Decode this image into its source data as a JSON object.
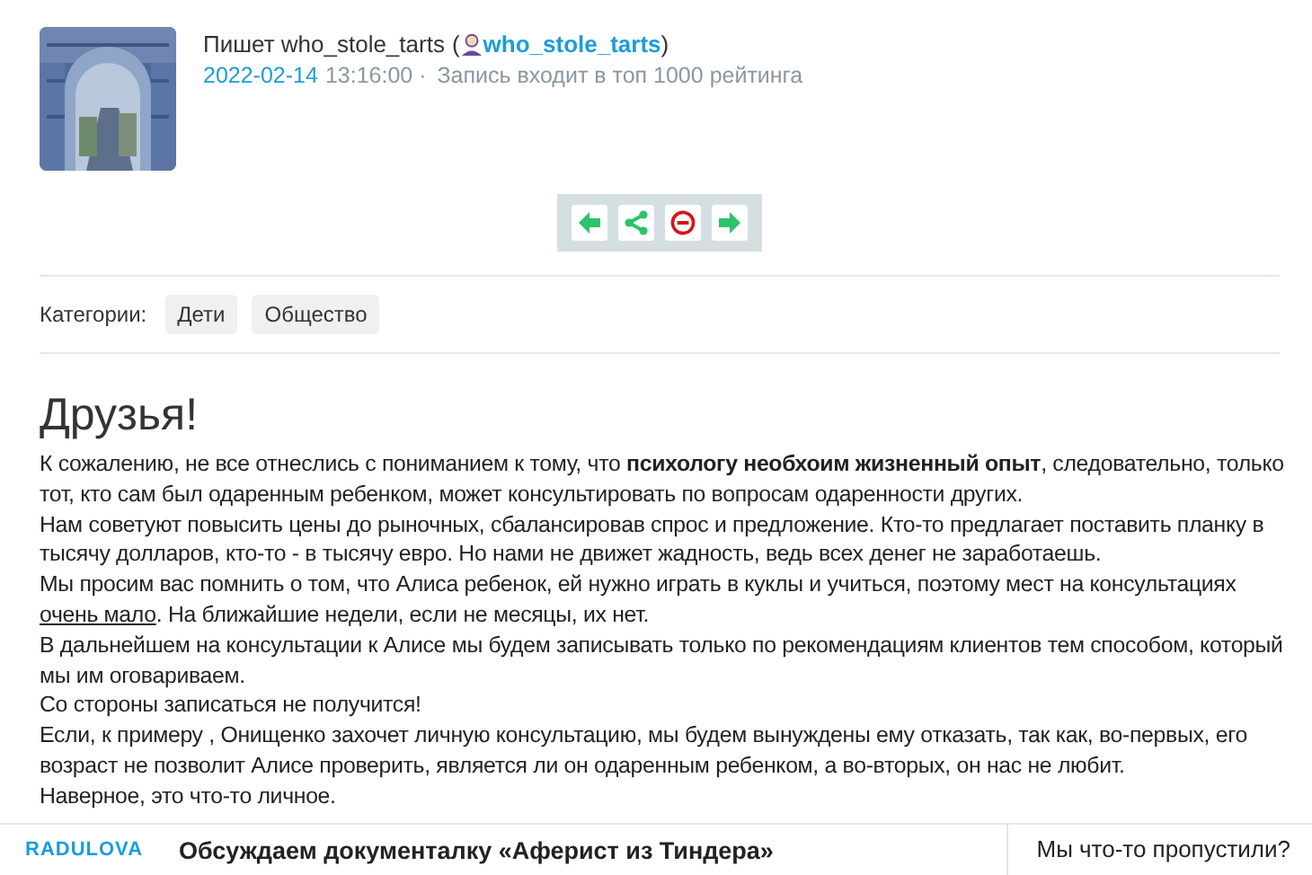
{
  "post": {
    "author_text": "Пишет who_stole_tarts",
    "open_paren": "(",
    "author_link": "who_stole_tarts",
    "close_paren": ")",
    "date": "2022-02-14",
    "time": "13:16:00 ·",
    "rating_note": "Запись входит в топ 1000 рейтинга"
  },
  "actions": [
    {
      "kind": "prev"
    },
    {
      "kind": "share"
    },
    {
      "kind": "block"
    },
    {
      "kind": "next"
    }
  ],
  "categories": {
    "label": "Категории:",
    "tags": [
      "Дети",
      "Общество"
    ]
  },
  "title": "Друзья!",
  "paragraphs": [
    {
      "parts": [
        {
          "kind": "text",
          "text": "К сожалению, не все отнеслись с пониманием к тому, что **психологу необхоим жизненный опыт**, следовательно, только тот, кто сам был одаренным ребенком, может консультировать по вопросам одаренности других."
        }
      ]
    },
    {
      "parts": [
        {
          "kind": "text",
          "text": "Нам советуют повысить цены до рыночных, сбалансировав спрос и предложение. Кто-то предлагает поставить планку в тысячу долларов, кто-то - в тысячу евро. Но нами не движет жадность, ведь всех денег не заработаешь."
        }
      ]
    },
    {
      "parts": [
        {
          "kind": "text",
          "text": "Мы просим вас помнить о том, что Алиса ребенок, ей нужно играть в куклы и учиться, поэтому мест на консультациях "
        },
        {
          "kind": "link",
          "text": "очень мало"
        },
        {
          "kind": "text",
          "text": ". На ближайшие недели, если не месяцы, их нет."
        }
      ]
    },
    {
      "parts": [
        {
          "kind": "text",
          "text": "В дальнейшем на консультации к Алисе мы будем записывать только по рекомендациям клиентов тем способом, который мы им оговариваем."
        }
      ]
    },
    {
      "parts": [
        {
          "kind": "text",
          "text": "Со стороны записаться не получится!"
        }
      ]
    },
    {
      "parts": [
        {
          "kind": "text",
          "text": "Если, к примеру , Онищенко захочет личную консультацию, мы будем вынуждены ему отказать, так как, во-первых, его возраст не позволит Алисе проверить, является ли он одаренным ребенком, а во-вторых, он нас не любит."
        }
      ]
    },
    {
      "parts": [
        {
          "kind": "text",
          "text": "Наверное, это что-то личное."
        }
      ]
    }
  ],
  "bottom_bar": {
    "brand": "RADULOVA",
    "headline": "Обсуждаем документалку «Аферист из Тиндера»",
    "side_link": "Мы что-то пропустили?"
  }
}
